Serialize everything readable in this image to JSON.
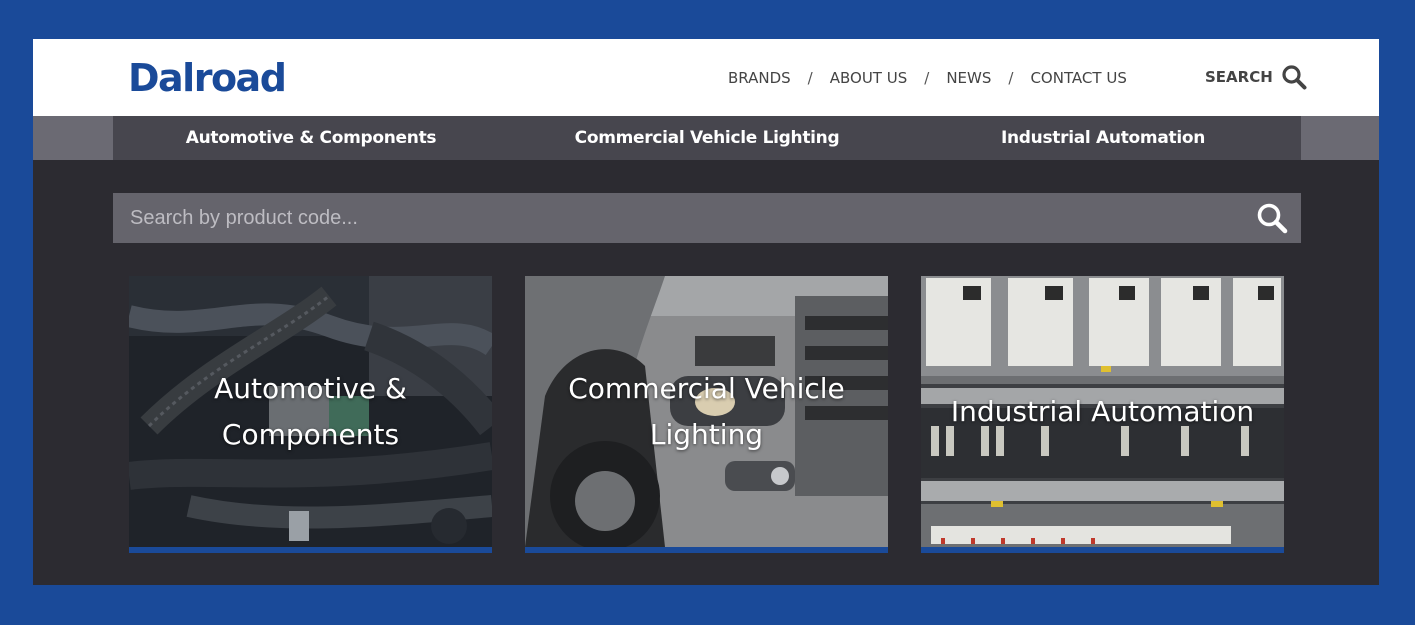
{
  "brand": {
    "logo_text": "Dalroad",
    "color": "#1a4a99"
  },
  "topnav": {
    "items": [
      "BRANDS",
      "ABOUT US",
      "NEWS",
      "CONTACT US"
    ],
    "separator": "/",
    "search_label": "SEARCH",
    "search_icon": "search-icon"
  },
  "categories": [
    "Automotive & Components",
    "Commercial Vehicle Lighting",
    "Industrial Automation"
  ],
  "product_search": {
    "placeholder": "Search by product code...",
    "icon": "search-icon"
  },
  "cards": [
    {
      "title": "Automotive & Components",
      "image": "engine-wiring-photo"
    },
    {
      "title": "Commercial Vehicle Lighting",
      "image": "truck-headlight-photo"
    },
    {
      "title": "Industrial Automation",
      "image": "control-panel-photo"
    }
  ],
  "colors": {
    "accent": "#1a4a99",
    "dark_bg": "#2c2b31",
    "category_bar": "#47464e",
    "search_bg": "#65646c"
  }
}
